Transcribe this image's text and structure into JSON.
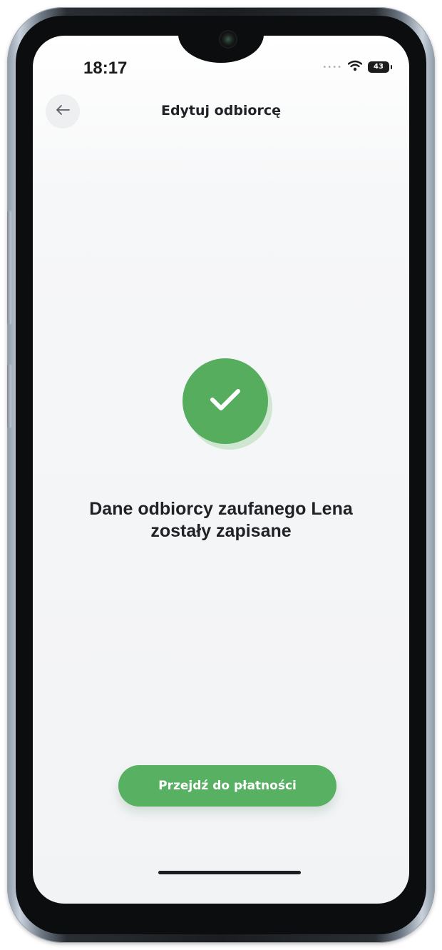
{
  "status_bar": {
    "time": "18:17",
    "battery": "43",
    "icons": [
      "signal-dots-icon",
      "wifi-icon",
      "battery-icon"
    ]
  },
  "header": {
    "back_icon": "arrow-left-icon",
    "title": "Edytuj odbiorcę"
  },
  "main": {
    "status_icon": "checkmark-icon",
    "message_line1": "Dane odbiorcy zaufanego Lena",
    "message_line2": "zostały zapisane"
  },
  "actions": {
    "primary_label": "Przejdź do płatności"
  },
  "colors": {
    "accent_green": "#56AD5E",
    "text_dark": "#1F2124",
    "background": "#F2F3F5"
  }
}
